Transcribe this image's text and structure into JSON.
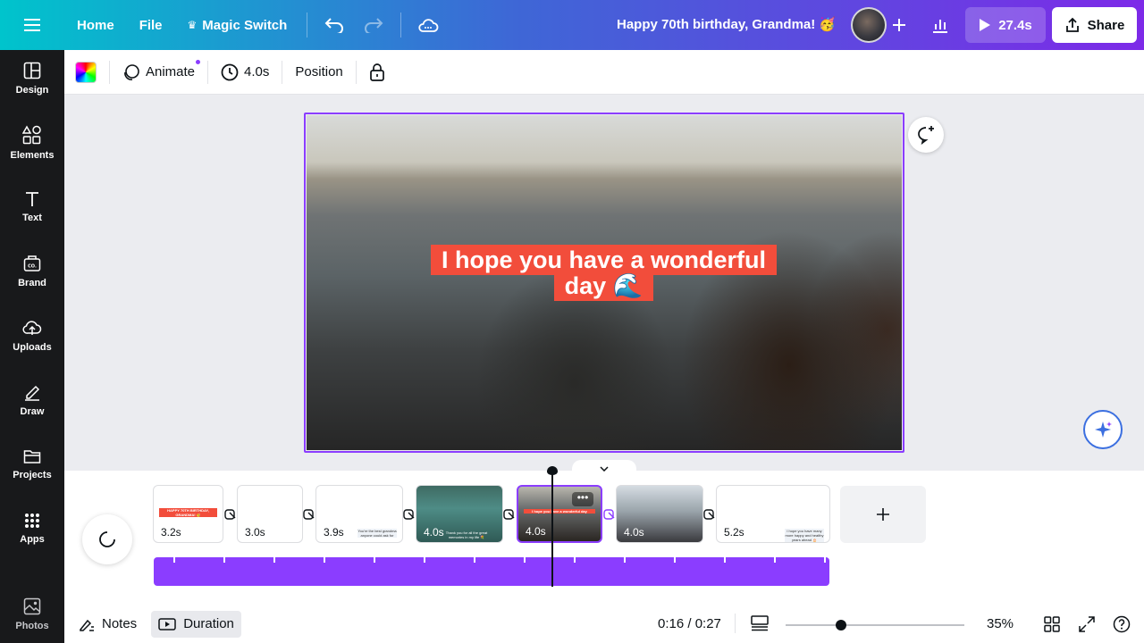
{
  "topbar": {
    "home": "Home",
    "file": "File",
    "magic_switch": "Magic Switch",
    "title": "Happy 70th birthday, Grandma! 🥳",
    "play_duration": "27.4s",
    "share": "Share"
  },
  "sidebar": {
    "items": [
      {
        "label": "Design",
        "icon": "design-icon"
      },
      {
        "label": "Elements",
        "icon": "elements-icon"
      },
      {
        "label": "Text",
        "icon": "text-icon"
      },
      {
        "label": "Brand",
        "icon": "brand-icon"
      },
      {
        "label": "Uploads",
        "icon": "uploads-icon"
      },
      {
        "label": "Draw",
        "icon": "draw-icon"
      },
      {
        "label": "Projects",
        "icon": "projects-icon"
      },
      {
        "label": "Apps",
        "icon": "apps-icon"
      },
      {
        "label": "Photos",
        "icon": "photos-icon"
      }
    ]
  },
  "toolbar": {
    "animate": "Animate",
    "duration": "4.0s",
    "position": "Position"
  },
  "canvas": {
    "caption": "I hope you have a wonderful day 🌊"
  },
  "timeline": {
    "clips": [
      {
        "duration": "3.2s",
        "thumb_text": "HAPPY 70TH BIRTHDAY, GRANDMA! 🥳"
      },
      {
        "duration": "3.0s",
        "thumb_text": ""
      },
      {
        "duration": "3.9s",
        "thumb_text": "You're the best grandma anyone could ask for"
      },
      {
        "duration": "4.0s",
        "thumb_text": "Thank you for all the great memories in my life 💐"
      },
      {
        "duration": "4.0s",
        "thumb_text": "I hope you have a wonderful day"
      },
      {
        "duration": "4.0s",
        "thumb_text": ""
      },
      {
        "duration": "5.2s",
        "thumb_text": "I hope you have many more happy and healthy years ahead 🎂"
      }
    ],
    "playhead_fraction": 0.59
  },
  "footer": {
    "notes": "Notes",
    "duration": "Duration",
    "timecode": "0:16 / 0:27",
    "zoom_level": "35%",
    "zoom_fraction": 0.31
  },
  "colors": {
    "accent": "#8b3dff",
    "caption_bg": "#f24d3b",
    "sidebar_bg": "#18191b"
  }
}
